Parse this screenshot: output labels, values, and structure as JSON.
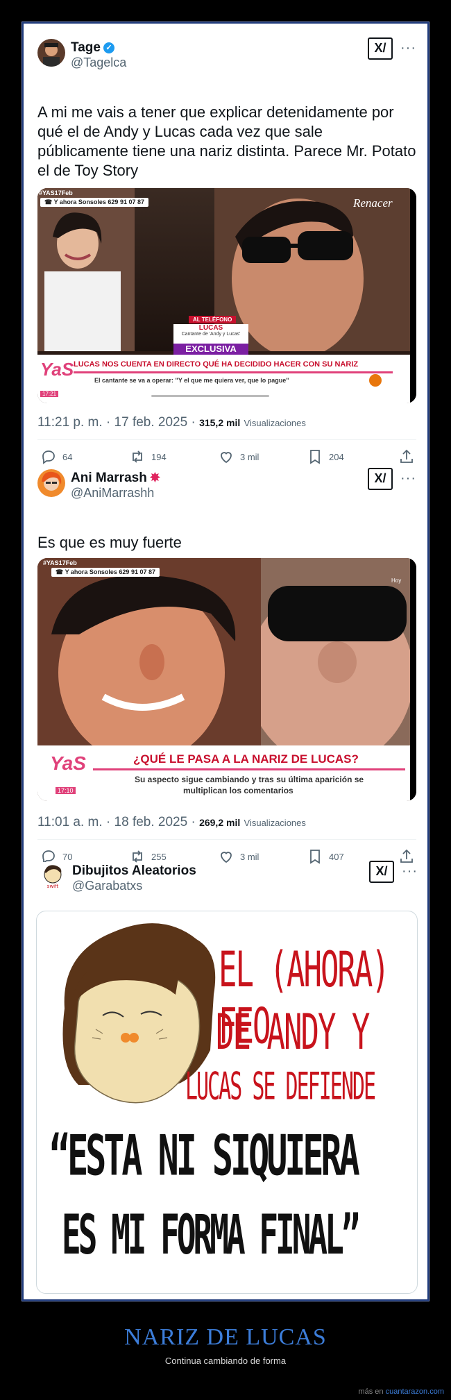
{
  "tweets": [
    {
      "name": "Tage",
      "handle": "@Tagelca",
      "verified": true,
      "grok_label": "X/",
      "more_label": "···",
      "text": "A mi me vais a tener que explicar detenidamente por qué el de Andy y Lucas cada vez que sale públicamente tiene una nariz distinta. Parece Mr. Potato el de Toy Story",
      "media": {
        "hashtag": "#YAS17Feb",
        "phone": "Y ahora Sonsoles  629 91 07 87",
        "network": "Renacer",
        "tag_small": "AL TELÉFONO",
        "name_label": "LUCAS",
        "name_sub": "Cantante de 'Andy y Lucas'",
        "exclusive": "EXCLUSIVA",
        "headline": "LUCAS NOS CUENTA EN DIRECTO QUÉ HA DECIDIDO HACER CON SU NARIZ",
        "subline": "El cantante se va a operar: \"Y el que me quiera ver, que lo pague\"",
        "time": "17:21",
        "logo": "YaS"
      },
      "timestamp": "11:21 p. m. · 17 feb. 2025 ·",
      "views": "315,2 mil",
      "views_label": "Visualizaciones",
      "replies": "64",
      "retweets": "194",
      "likes": "3 mil",
      "bookmarks": "204"
    },
    {
      "name": "Ani Marrash",
      "handle": "@AniMarrashh",
      "badge": "✸",
      "grok_label": "X/",
      "more_label": "···",
      "text": "Es que es muy fuerte",
      "media": {
        "hashtag": "#YAS17Feb",
        "phone": "Y ahora Sonsoles  629 91 07 87",
        "network": "Hoy",
        "headline": "¿QUÉ LE PASA A LA NARIZ DE LUCAS?",
        "subline1": "Su aspecto sigue cambiando y tras su última aparición se",
        "subline2": "multiplican los comentarios",
        "time": "17:10",
        "logo": "YaS"
      },
      "timestamp": "11:01 a. m. · 18 feb. 2025 ·",
      "views": "269,2 mil",
      "views_label": "Visualizaciones",
      "replies": "70",
      "retweets": "255",
      "likes": "3 mil",
      "bookmarks": "407"
    },
    {
      "name": "Dibujitos Aleatorios",
      "handle": "@Garabatxs",
      "grok_label": "X/",
      "more_label": "···",
      "drawing": {
        "line1": "EL (AHORA) FEO",
        "line2": "DE ANDY Y",
        "line3": "LUCAS SE DEFIENDE",
        "quote1": "“ESTA NI SIQUIERA",
        "quote2": "ES MI FORMA FINAL”"
      }
    }
  ],
  "caption": {
    "title": "NARIZ DE LUCAS",
    "subtitle": "Continua cambiando de forma"
  },
  "footer": {
    "prefix": "más en",
    "site": "cuantarazon.com"
  },
  "colors": {
    "background": "#000000",
    "card": "#ffffff",
    "caption_title": "#3c7dd9",
    "tv_red": "#c8102e",
    "tv_pink": "#e0417a",
    "drawing_red": "#c8131c",
    "verified": "#1d9bf0"
  }
}
